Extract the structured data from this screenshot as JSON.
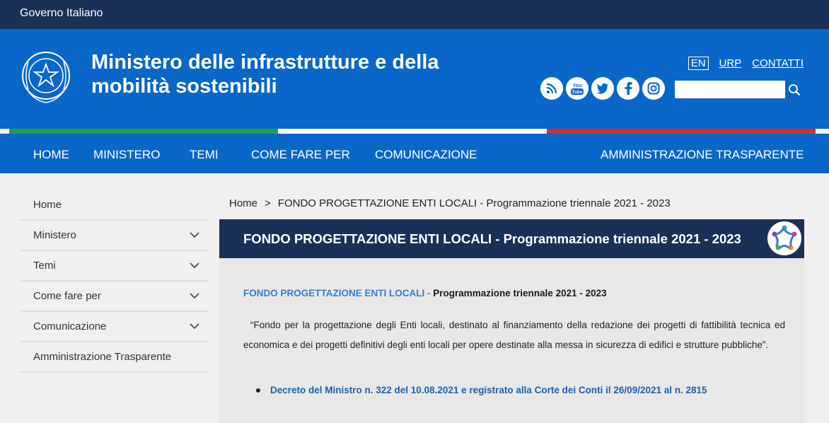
{
  "topbar": {
    "label": "Governo Italiano"
  },
  "header": {
    "title": "Ministero delle infrastrutture e della mobilità sostenibili",
    "lang": "EN",
    "links": [
      "URP",
      "CONTATTI"
    ],
    "social": [
      {
        "name": "rss-icon"
      },
      {
        "name": "youtube-icon",
        "label": "You Tube"
      },
      {
        "name": "twitter-icon"
      },
      {
        "name": "facebook-icon"
      },
      {
        "name": "instagram-icon"
      }
    ],
    "search_placeholder": ""
  },
  "colors": {
    "dark_blue": "#1a3057",
    "blue": "#0a66c8",
    "green": "#1e9e4a",
    "white": "#ffffff",
    "red": "#d02e3a"
  },
  "nav": {
    "items": [
      "HOME",
      "MINISTERO",
      "TEMI",
      "COME FARE PER",
      "COMUNICAZIONE",
      "AMMINISTRAZIONE TRASPARENTE"
    ]
  },
  "sidebar": {
    "items": [
      {
        "label": "Home",
        "expandable": false
      },
      {
        "label": "Ministero",
        "expandable": true
      },
      {
        "label": "Temi",
        "expandable": true
      },
      {
        "label": "Come fare per",
        "expandable": true
      },
      {
        "label": "Comunicazione",
        "expandable": true
      },
      {
        "label": "Amministrazione Trasparente",
        "expandable": false
      }
    ]
  },
  "breadcrumb": {
    "home": "Home",
    "separator": ">",
    "current": "FONDO PROGETTAZIONE ENTI LOCALI - Programmazione triennale 2021 - 2023"
  },
  "content": {
    "heading": "FONDO PROGETTAZIONE ENTI LOCALI - Programmazione triennale 2021 - 2023",
    "subtitle_blue": "FONDO PROGETTAZIONE ENTI LOCALI -",
    "subtitle_black": "Programmazione triennale 2021 - 2023",
    "quote": "“Fondo per la progettazione degli Enti locali, destinato al finanziamento della redazione dei progetti di fattibilità tecnica ed economica e dei progetti definitivi degli enti locali per opere destinate alla messa in sicurezza di edifici e strutture pubbliche”.",
    "link": "Decreto del Ministro n. 322 del 10.08.2021 e registrato alla Corte dei Conti il 26/09/2021 al n. 2815"
  }
}
